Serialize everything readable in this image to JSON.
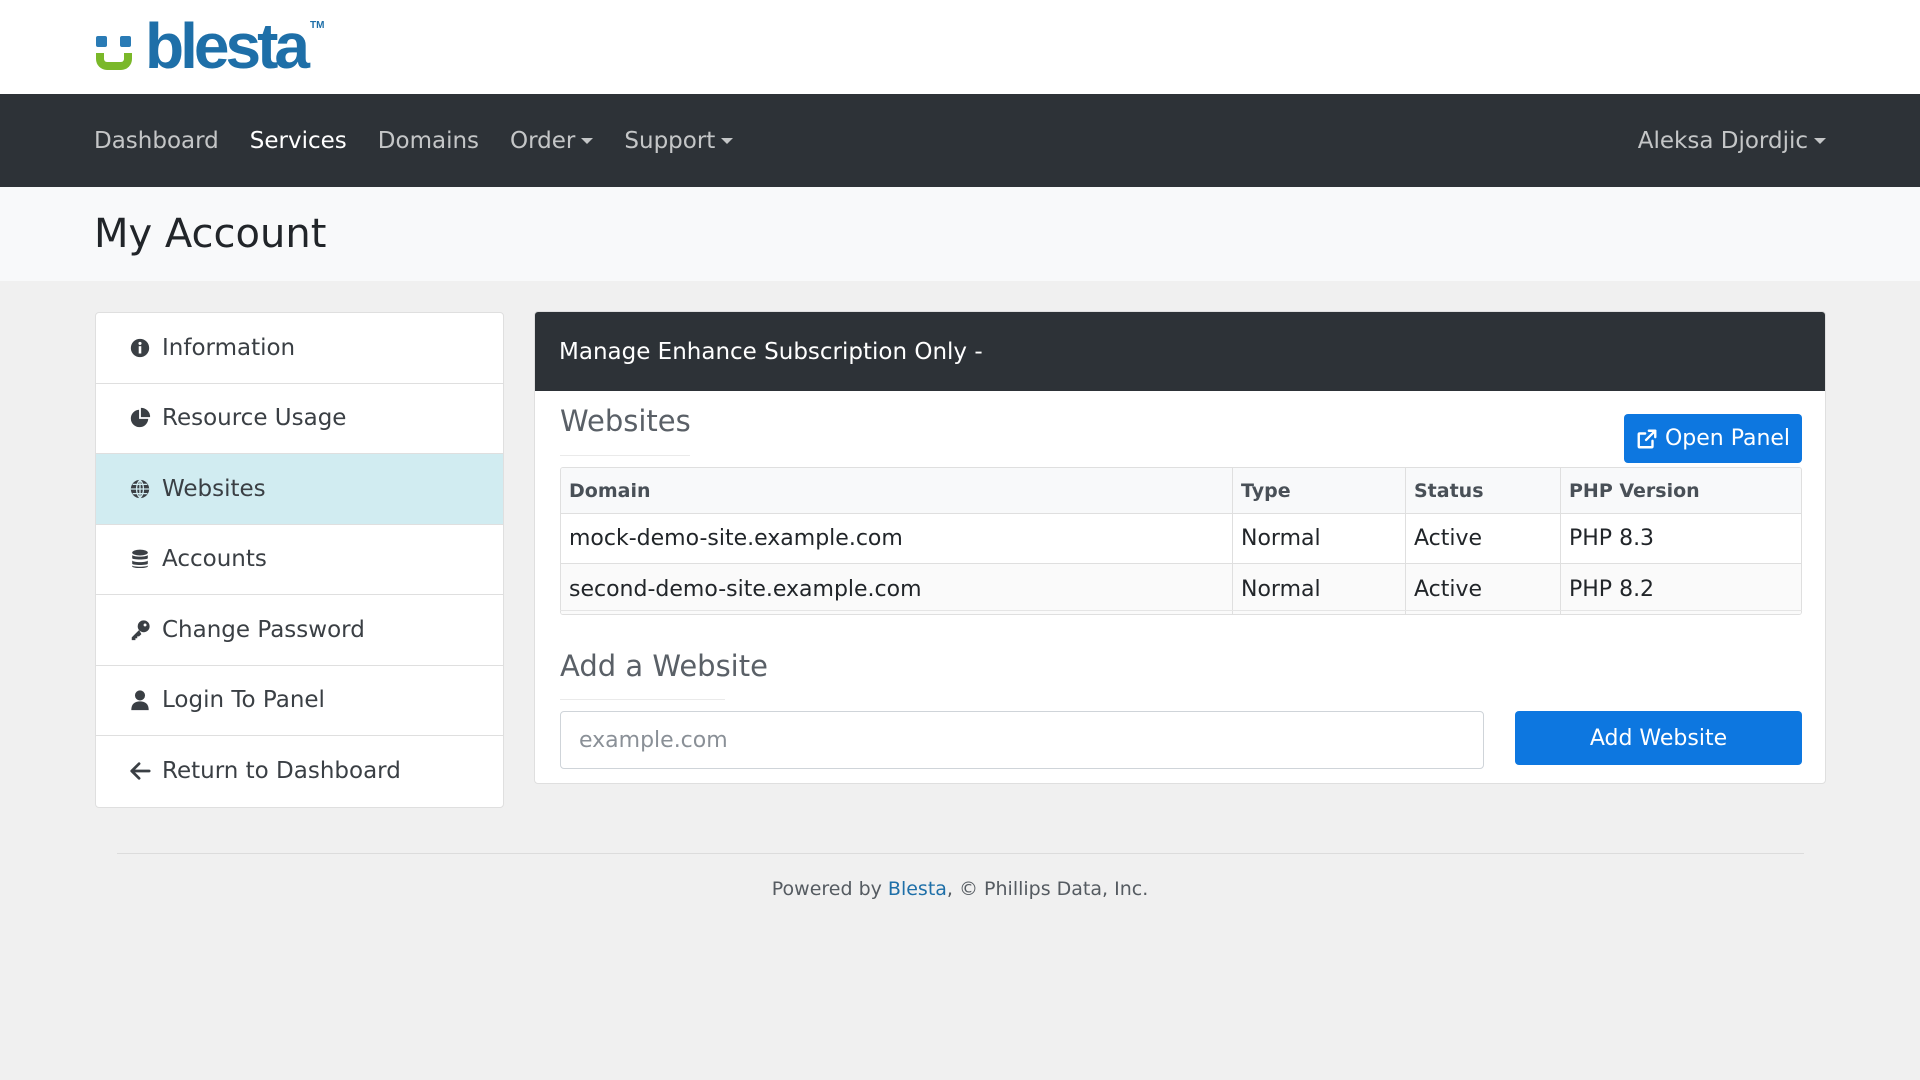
{
  "brand": {
    "logo_text": "blesta",
    "logo_tm": "TM"
  },
  "nav": {
    "items": [
      {
        "label": "Dashboard",
        "active": false,
        "dropdown": false
      },
      {
        "label": "Services",
        "active": true,
        "dropdown": false
      },
      {
        "label": "Domains",
        "active": false,
        "dropdown": false
      },
      {
        "label": "Order",
        "active": false,
        "dropdown": true
      },
      {
        "label": "Support",
        "active": false,
        "dropdown": true
      }
    ],
    "user": "Aleksa Djordjic"
  },
  "page": {
    "title": "My Account"
  },
  "sidebar": {
    "items": [
      {
        "label": "Information",
        "icon": "info-circle-icon"
      },
      {
        "label": "Resource Usage",
        "icon": "pie-chart-icon"
      },
      {
        "label": "Websites",
        "icon": "globe-icon",
        "active": true
      },
      {
        "label": "Accounts",
        "icon": "database-icon"
      },
      {
        "label": "Change Password",
        "icon": "key-icon"
      },
      {
        "label": "Login To Panel",
        "icon": "user-icon"
      },
      {
        "label": "Return to Dashboard",
        "icon": "arrow-left-icon"
      }
    ]
  },
  "panel": {
    "header": "Manage Enhance Subscription Only -",
    "websites_title": "Websites",
    "open_panel_label": "Open Panel",
    "table": {
      "columns": [
        "Domain",
        "Type",
        "Status",
        "PHP Version"
      ],
      "rows": [
        [
          "mock-demo-site.example.com",
          "Normal",
          "Active",
          "PHP 8.3"
        ],
        [
          "second-demo-site.example.com",
          "Normal",
          "Active",
          "PHP 8.2"
        ]
      ]
    },
    "add_title": "Add a Website",
    "add_placeholder": "example.com",
    "add_button_label": "Add Website"
  },
  "footer": {
    "prefix": "Powered by ",
    "link": "Blesta",
    "suffix": ", © Phillips Data, Inc."
  },
  "colors": {
    "navbar": "#2d3237",
    "primary_button": "#0d77e0",
    "active_sidebar": "#d1ecf1",
    "brand_blue": "#1e6fa8",
    "brand_green": "#7ab829"
  }
}
